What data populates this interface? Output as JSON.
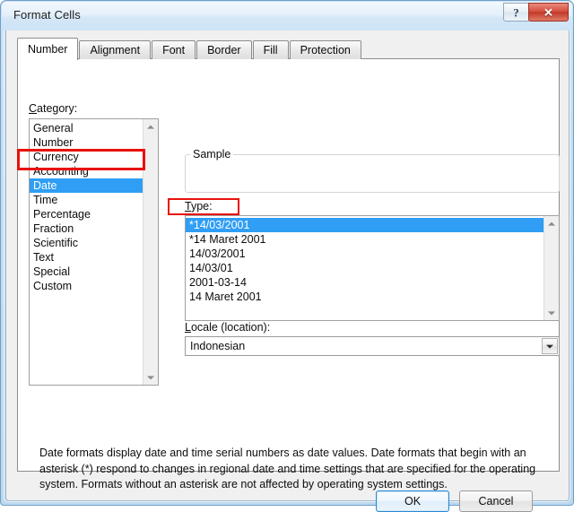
{
  "window": {
    "title": "Format Cells",
    "caption_buttons": [
      {
        "name": "help-button",
        "glyph": "?"
      },
      {
        "name": "close-button",
        "glyph": "✕"
      }
    ]
  },
  "tabs": [
    {
      "label": "Number",
      "active": true
    },
    {
      "label": "Alignment",
      "active": false
    },
    {
      "label": "Font",
      "active": false
    },
    {
      "label": "Border",
      "active": false
    },
    {
      "label": "Fill",
      "active": false
    },
    {
      "label": "Protection",
      "active": false
    }
  ],
  "category": {
    "label_accel": "C",
    "label_rest": "ategory:",
    "items": [
      {
        "label": "General",
        "selected": false
      },
      {
        "label": "Number",
        "selected": false
      },
      {
        "label": "Currency",
        "selected": false
      },
      {
        "label": "Accounting",
        "selected": false
      },
      {
        "label": "Date",
        "selected": true
      },
      {
        "label": "Time",
        "selected": false
      },
      {
        "label": "Percentage",
        "selected": false
      },
      {
        "label": "Fraction",
        "selected": false
      },
      {
        "label": "Scientific",
        "selected": false
      },
      {
        "label": "Text",
        "selected": false
      },
      {
        "label": "Special",
        "selected": false
      },
      {
        "label": "Custom",
        "selected": false
      }
    ]
  },
  "sample": {
    "legend": "Sample",
    "value": ""
  },
  "type": {
    "label_accel": "T",
    "label_rest": "ype:",
    "items": [
      {
        "label": "*14/03/2001",
        "selected": true
      },
      {
        "label": "*14 Maret 2001",
        "selected": false
      },
      {
        "label": "14/03/2001",
        "selected": false
      },
      {
        "label": "14/03/01",
        "selected": false
      },
      {
        "label": "2001-03-14",
        "selected": false
      },
      {
        "label": "14 Maret 2001",
        "selected": false
      }
    ]
  },
  "locale": {
    "label_accel": "L",
    "label_rest": "ocale (location):",
    "value": "Indonesian"
  },
  "description": "Date formats display date and time serial numbers as date values.  Date formats that begin with an asterisk (*) respond to changes in regional date and time settings that are specified for the operating system. Formats without an asterisk are not affected by operating system settings.",
  "buttons": {
    "ok": "OK",
    "cancel": "Cancel"
  },
  "annotations": {
    "accent_color": "#e8120b",
    "highlighted_category": "Date",
    "highlighted_type": "14/03/01"
  },
  "colors": {
    "selection_blue": "#2f9ef4",
    "title_bar": "#dceafa",
    "dialog_background": "#f0f0f0",
    "close_button_red": "#c23a28"
  }
}
